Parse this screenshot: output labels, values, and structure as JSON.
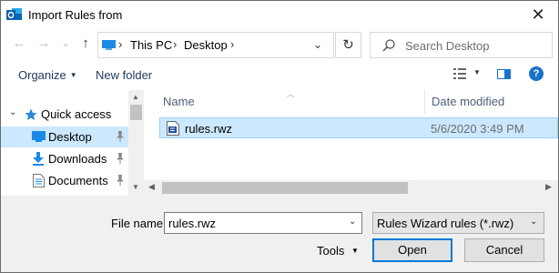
{
  "window": {
    "title": "Import Rules from",
    "close_glyph": "✕"
  },
  "nav": {
    "back_glyph": "←",
    "forward_glyph": "→",
    "recent_glyph": "⌄",
    "up_glyph": "↑"
  },
  "address": {
    "crumbs": [
      "This PC",
      "Desktop"
    ],
    "separator": "›",
    "dropdown_glyph": "⌄",
    "refresh_glyph": "↻"
  },
  "search": {
    "placeholder": "Search Desktop"
  },
  "toolbar": {
    "organize": "Organize",
    "new_folder": "New folder",
    "help_glyph": "?"
  },
  "sidebar": {
    "items": [
      {
        "label": "Quick access",
        "icon": "star-icon",
        "expanded": true
      },
      {
        "label": "Desktop",
        "icon": "desktop-folder-icon",
        "pinned": true,
        "selected": true
      },
      {
        "label": "Downloads",
        "icon": "download-folder-icon",
        "pinned": true
      },
      {
        "label": "Documents",
        "icon": "documents-folder-icon",
        "pinned": true
      }
    ]
  },
  "filelist": {
    "columns": [
      "Name",
      "Date modified"
    ],
    "rows": [
      {
        "name": "rules.rwz",
        "date": "5/6/2020 3:49 PM",
        "icon": "rwz-file-icon",
        "selected": true
      }
    ]
  },
  "footer": {
    "file_name_label": "File name:",
    "file_name_value": "rules.rwz",
    "file_type": "Rules Wizard rules (*.rwz)",
    "tools_label": "Tools",
    "open_label": "Open",
    "cancel_label": "Cancel"
  },
  "colors": {
    "selection": "#cce8ff",
    "accent": "#0078d7",
    "help_icon": "#1a73c8"
  }
}
